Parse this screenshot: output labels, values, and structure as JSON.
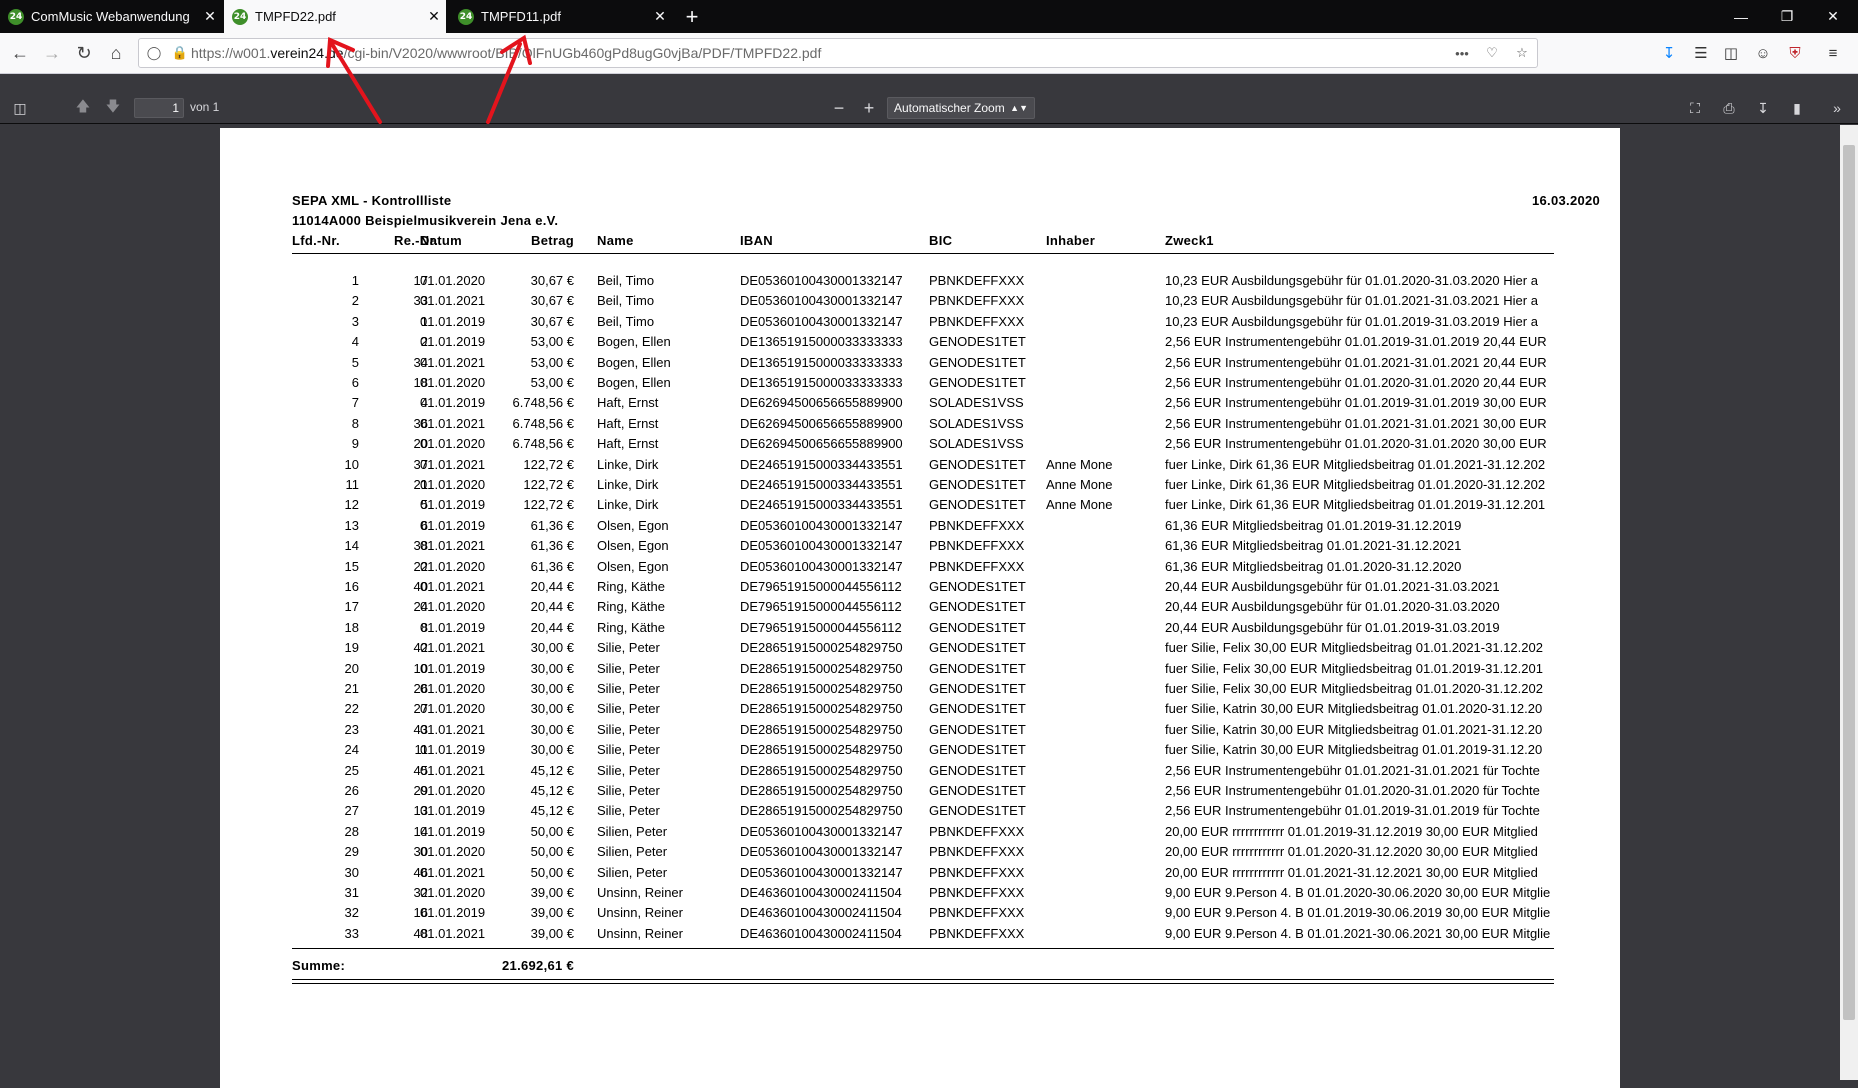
{
  "browser": {
    "tabs": [
      {
        "title": "ComMusic Webanwendung",
        "favicon": "24"
      },
      {
        "title": "TMPFD22.pdf",
        "favicon": "24"
      },
      {
        "title": "TMPFD11.pdf",
        "favicon": "24"
      }
    ],
    "url_prefix": "https://w001.",
    "url_domain": "verein24.de",
    "url_rest": "/cgi-bin/V2020/wwwroot/BIB/OlFnUGb460gPd8ugG0vjBa/PDF/TMPFD22.pdf"
  },
  "pdf_toolbar": {
    "page_number": "1",
    "page_of": "von 1",
    "zoom_label": "Automatischer Zoom"
  },
  "document": {
    "title": "SEPA XML - Kontrollliste",
    "date": "16.03.2020",
    "org": "11014A000 Beispielmusikverein Jena e.V.",
    "columns": {
      "lfd": "Lfd.-Nr.",
      "re": "Re.-Nr.",
      "datum": "Datum",
      "betrag": "Betrag",
      "name": "Name",
      "iban": "IBAN",
      "bic": "BIC",
      "inhaber": "Inhaber",
      "zweck": "Zweck1"
    },
    "rows": [
      {
        "lfd": "1",
        "re": "17",
        "datum": "01.01.2020",
        "betrag": "30,67 €",
        "name": "Beil, Timo",
        "iban": "DE05360100430001332147",
        "bic": "PBNKDEFFXXX",
        "inhaber": "",
        "zweck": "10,23 EUR Ausbildungsgebühr für 01.01.2020-31.03.2020 Hier a"
      },
      {
        "lfd": "2",
        "re": "33",
        "datum": "01.01.2021",
        "betrag": "30,67 €",
        "name": "Beil, Timo",
        "iban": "DE05360100430001332147",
        "bic": "PBNKDEFFXXX",
        "inhaber": "",
        "zweck": "10,23 EUR Ausbildungsgebühr für 01.01.2021-31.03.2021 Hier a"
      },
      {
        "lfd": "3",
        "re": "1",
        "datum": "01.01.2019",
        "betrag": "30,67 €",
        "name": "Beil, Timo",
        "iban": "DE05360100430001332147",
        "bic": "PBNKDEFFXXX",
        "inhaber": "",
        "zweck": "10,23 EUR Ausbildungsgebühr für 01.01.2019-31.03.2019 Hier a"
      },
      {
        "lfd": "4",
        "re": "2",
        "datum": "01.01.2019",
        "betrag": "53,00 €",
        "name": "Bogen, Ellen",
        "iban": "DE13651915000033333333",
        "bic": "GENODES1TET",
        "inhaber": "",
        "zweck": "2,56 EUR Instrumentengebühr 01.01.2019-31.01.2019 20,44 EUR"
      },
      {
        "lfd": "5",
        "re": "34",
        "datum": "01.01.2021",
        "betrag": "53,00 €",
        "name": "Bogen, Ellen",
        "iban": "DE13651915000033333333",
        "bic": "GENODES1TET",
        "inhaber": "",
        "zweck": "2,56 EUR Instrumentengebühr 01.01.2021-31.01.2021 20,44 EUR"
      },
      {
        "lfd": "6",
        "re": "18",
        "datum": "01.01.2020",
        "betrag": "53,00 €",
        "name": "Bogen, Ellen",
        "iban": "DE13651915000033333333",
        "bic": "GENODES1TET",
        "inhaber": "",
        "zweck": "2,56 EUR Instrumentengebühr 01.01.2020-31.01.2020 20,44 EUR"
      },
      {
        "lfd": "7",
        "re": "4",
        "datum": "01.01.2019",
        "betrag": "6.748,56 €",
        "name": "Haft, Ernst",
        "iban": "DE62694500656655889900",
        "bic": "SOLADES1VSS",
        "inhaber": "",
        "zweck": "2,56 EUR Instrumentengebühr 01.01.2019-31.01.2019 30,00 EUR"
      },
      {
        "lfd": "8",
        "re": "36",
        "datum": "01.01.2021",
        "betrag": "6.748,56 €",
        "name": "Haft, Ernst",
        "iban": "DE62694500656655889900",
        "bic": "SOLADES1VSS",
        "inhaber": "",
        "zweck": "2,56 EUR Instrumentengebühr 01.01.2021-31.01.2021 30,00 EUR"
      },
      {
        "lfd": "9",
        "re": "20",
        "datum": "01.01.2020",
        "betrag": "6.748,56 €",
        "name": "Haft, Ernst",
        "iban": "DE62694500656655889900",
        "bic": "SOLADES1VSS",
        "inhaber": "",
        "zweck": "2,56 EUR Instrumentengebühr 01.01.2020-31.01.2020 30,00 EUR"
      },
      {
        "lfd": "10",
        "re": "37",
        "datum": "01.01.2021",
        "betrag": "122,72 €",
        "name": "Linke, Dirk",
        "iban": "DE24651915000334433551",
        "bic": "GENODES1TET",
        "inhaber": "Anne Mone",
        "zweck": "fuer Linke, Dirk 61,36 EUR Mitgliedsbeitrag 01.01.2021-31.12.202"
      },
      {
        "lfd": "11",
        "re": "21",
        "datum": "01.01.2020",
        "betrag": "122,72 €",
        "name": "Linke, Dirk",
        "iban": "DE24651915000334433551",
        "bic": "GENODES1TET",
        "inhaber": "Anne Mone",
        "zweck": "fuer Linke, Dirk 61,36 EUR Mitgliedsbeitrag 01.01.2020-31.12.202"
      },
      {
        "lfd": "12",
        "re": "5",
        "datum": "01.01.2019",
        "betrag": "122,72 €",
        "name": "Linke, Dirk",
        "iban": "DE24651915000334433551",
        "bic": "GENODES1TET",
        "inhaber": "Anne Mone",
        "zweck": "fuer Linke, Dirk 61,36 EUR Mitgliedsbeitrag 01.01.2019-31.12.201"
      },
      {
        "lfd": "13",
        "re": "6",
        "datum": "01.01.2019",
        "betrag": "61,36 €",
        "name": "Olsen, Egon",
        "iban": "DE05360100430001332147",
        "bic": "PBNKDEFFXXX",
        "inhaber": "",
        "zweck": "61,36 EUR Mitgliedsbeitrag 01.01.2019-31.12.2019"
      },
      {
        "lfd": "14",
        "re": "38",
        "datum": "01.01.2021",
        "betrag": "61,36 €",
        "name": "Olsen, Egon",
        "iban": "DE05360100430001332147",
        "bic": "PBNKDEFFXXX",
        "inhaber": "",
        "zweck": "61,36 EUR Mitgliedsbeitrag 01.01.2021-31.12.2021"
      },
      {
        "lfd": "15",
        "re": "22",
        "datum": "01.01.2020",
        "betrag": "61,36 €",
        "name": "Olsen, Egon",
        "iban": "DE05360100430001332147",
        "bic": "PBNKDEFFXXX",
        "inhaber": "",
        "zweck": "61,36 EUR Mitgliedsbeitrag 01.01.2020-31.12.2020"
      },
      {
        "lfd": "16",
        "re": "40",
        "datum": "01.01.2021",
        "betrag": "20,44 €",
        "name": "Ring, Käthe",
        "iban": "DE79651915000044556112",
        "bic": "GENODES1TET",
        "inhaber": "",
        "zweck": "20,44 EUR Ausbildungsgebühr für 01.01.2021-31.03.2021"
      },
      {
        "lfd": "17",
        "re": "24",
        "datum": "01.01.2020",
        "betrag": "20,44 €",
        "name": "Ring, Käthe",
        "iban": "DE79651915000044556112",
        "bic": "GENODES1TET",
        "inhaber": "",
        "zweck": "20,44 EUR Ausbildungsgebühr für 01.01.2020-31.03.2020"
      },
      {
        "lfd": "18",
        "re": "8",
        "datum": "01.01.2019",
        "betrag": "20,44 €",
        "name": "Ring, Käthe",
        "iban": "DE79651915000044556112",
        "bic": "GENODES1TET",
        "inhaber": "",
        "zweck": "20,44 EUR Ausbildungsgebühr für 01.01.2019-31.03.2019"
      },
      {
        "lfd": "19",
        "re": "42",
        "datum": "01.01.2021",
        "betrag": "30,00 €",
        "name": "Silie, Peter",
        "iban": "DE28651915000254829750",
        "bic": "GENODES1TET",
        "inhaber": "",
        "zweck": "fuer Silie, Felix 30,00 EUR Mitgliedsbeitrag 01.01.2021-31.12.202"
      },
      {
        "lfd": "20",
        "re": "10",
        "datum": "01.01.2019",
        "betrag": "30,00 €",
        "name": "Silie, Peter",
        "iban": "DE28651915000254829750",
        "bic": "GENODES1TET",
        "inhaber": "",
        "zweck": "fuer Silie, Felix 30,00 EUR Mitgliedsbeitrag 01.01.2019-31.12.201"
      },
      {
        "lfd": "21",
        "re": "26",
        "datum": "01.01.2020",
        "betrag": "30,00 €",
        "name": "Silie, Peter",
        "iban": "DE28651915000254829750",
        "bic": "GENODES1TET",
        "inhaber": "",
        "zweck": "fuer Silie, Felix 30,00 EUR Mitgliedsbeitrag 01.01.2020-31.12.202"
      },
      {
        "lfd": "22",
        "re": "27",
        "datum": "01.01.2020",
        "betrag": "30,00 €",
        "name": "Silie, Peter",
        "iban": "DE28651915000254829750",
        "bic": "GENODES1TET",
        "inhaber": "",
        "zweck": "fuer Silie, Katrin 30,00 EUR Mitgliedsbeitrag 01.01.2020-31.12.20"
      },
      {
        "lfd": "23",
        "re": "43",
        "datum": "01.01.2021",
        "betrag": "30,00 €",
        "name": "Silie, Peter",
        "iban": "DE28651915000254829750",
        "bic": "GENODES1TET",
        "inhaber": "",
        "zweck": "fuer Silie, Katrin 30,00 EUR Mitgliedsbeitrag 01.01.2021-31.12.20"
      },
      {
        "lfd": "24",
        "re": "11",
        "datum": "01.01.2019",
        "betrag": "30,00 €",
        "name": "Silie, Peter",
        "iban": "DE28651915000254829750",
        "bic": "GENODES1TET",
        "inhaber": "",
        "zweck": "fuer Silie, Katrin 30,00 EUR Mitgliedsbeitrag 01.01.2019-31.12.20"
      },
      {
        "lfd": "25",
        "re": "45",
        "datum": "01.01.2021",
        "betrag": "45,12 €",
        "name": "Silie, Peter",
        "iban": "DE28651915000254829750",
        "bic": "GENODES1TET",
        "inhaber": "",
        "zweck": "2,56 EUR Instrumentengebühr 01.01.2021-31.01.2021 für Tochte"
      },
      {
        "lfd": "26",
        "re": "29",
        "datum": "01.01.2020",
        "betrag": "45,12 €",
        "name": "Silie, Peter",
        "iban": "DE28651915000254829750",
        "bic": "GENODES1TET",
        "inhaber": "",
        "zweck": "2,56 EUR Instrumentengebühr 01.01.2020-31.01.2020 für Tochte"
      },
      {
        "lfd": "27",
        "re": "13",
        "datum": "01.01.2019",
        "betrag": "45,12 €",
        "name": "Silie, Peter",
        "iban": "DE28651915000254829750",
        "bic": "GENODES1TET",
        "inhaber": "",
        "zweck": "2,56 EUR Instrumentengebühr 01.01.2019-31.01.2019 für Tochte"
      },
      {
        "lfd": "28",
        "re": "14",
        "datum": "01.01.2019",
        "betrag": "50,00 €",
        "name": "Silien, Peter",
        "iban": "DE05360100430001332147",
        "bic": "PBNKDEFFXXX",
        "inhaber": "",
        "zweck": "20,00 EUR rrrrrrrrrrrr 01.01.2019-31.12.2019 30,00 EUR Mitglied"
      },
      {
        "lfd": "29",
        "re": "30",
        "datum": "01.01.2020",
        "betrag": "50,00 €",
        "name": "Silien, Peter",
        "iban": "DE05360100430001332147",
        "bic": "PBNKDEFFXXX",
        "inhaber": "",
        "zweck": "20,00 EUR rrrrrrrrrrrr 01.01.2020-31.12.2020 30,00 EUR Mitglied"
      },
      {
        "lfd": "30",
        "re": "46",
        "datum": "01.01.2021",
        "betrag": "50,00 €",
        "name": "Silien, Peter",
        "iban": "DE05360100430001332147",
        "bic": "PBNKDEFFXXX",
        "inhaber": "",
        "zweck": "20,00 EUR rrrrrrrrrrrr 01.01.2021-31.12.2021 30,00 EUR Mitglied"
      },
      {
        "lfd": "31",
        "re": "32",
        "datum": "01.01.2020",
        "betrag": "39,00 €",
        "name": "Unsinn, Reiner",
        "iban": "DE46360100430002411504",
        "bic": "PBNKDEFFXXX",
        "inhaber": "",
        "zweck": "9,00 EUR 9.Person 4. B 01.01.2020-30.06.2020 30,00 EUR Mitglie"
      },
      {
        "lfd": "32",
        "re": "16",
        "datum": "01.01.2019",
        "betrag": "39,00 €",
        "name": "Unsinn, Reiner",
        "iban": "DE46360100430002411504",
        "bic": "PBNKDEFFXXX",
        "inhaber": "",
        "zweck": "9,00 EUR 9.Person 4. B 01.01.2019-30.06.2019 30,00 EUR Mitglie"
      },
      {
        "lfd": "33",
        "re": "48",
        "datum": "01.01.2021",
        "betrag": "39,00 €",
        "name": "Unsinn, Reiner",
        "iban": "DE46360100430002411504",
        "bic": "PBNKDEFFXXX",
        "inhaber": "",
        "zweck": "9,00 EUR 9.Person 4. B 01.01.2021-30.06.2021 30,00 EUR Mitglie"
      }
    ],
    "sum_label": "Summe:",
    "sum_value": "21.692,61 €"
  },
  "colors": {
    "annotation_arrow": "#e3141d",
    "favicon": "#3f8f2a",
    "tab_bar": "#0c0c0d",
    "pdf_toolbar": "#38383d"
  }
}
